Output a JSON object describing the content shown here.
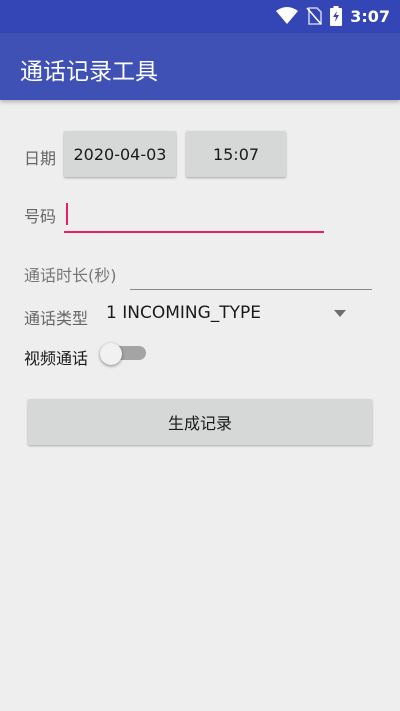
{
  "status_bar": {
    "time": "3:07",
    "icons": [
      "wifi-icon",
      "no-sim-icon",
      "battery-charging-icon"
    ]
  },
  "app_bar": {
    "title": "通话记录工具"
  },
  "form": {
    "date_label": "日期",
    "date_value": "2020-04-03",
    "time_value": "15:07",
    "number_label": "号码",
    "number_value": "",
    "duration_placeholder": "通话时长(秒)",
    "type_label": "通话类型",
    "type_value": "1 INCOMING_TYPE",
    "video_label": "视频通话",
    "video_on": false,
    "generate_label": "生成记录"
  },
  "colors": {
    "status_bar": "#3446b6",
    "app_bar": "#3f51b5",
    "accent": "#e91e63",
    "background": "#eeeeee"
  }
}
